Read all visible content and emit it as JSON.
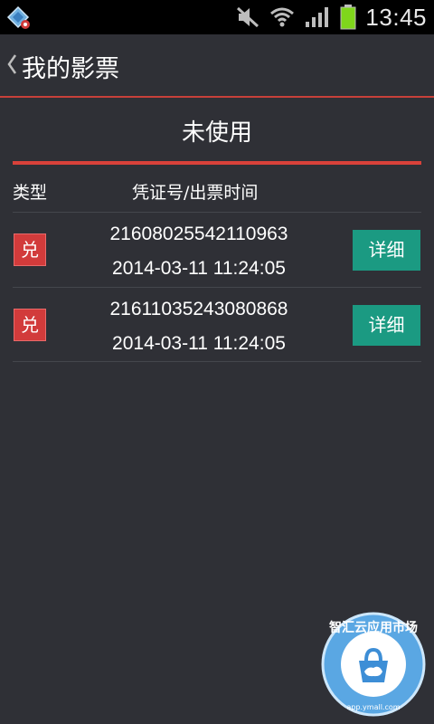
{
  "status_bar": {
    "time": "13:45",
    "icons": [
      "app-notification-icon",
      "mute-icon",
      "wifi-icon",
      "signal-icon",
      "battery-icon"
    ]
  },
  "header": {
    "back_icon": "chevron-left-icon",
    "title": "我的影票"
  },
  "tab": {
    "label": "未使用",
    "underline_color": "#d9413a"
  },
  "columns": {
    "type": "类型",
    "code_time": "凭证号/出票时间"
  },
  "tickets": [
    {
      "type": "兑",
      "code": "21608025542110963",
      "time": "2014-03-11 11:24:05",
      "action": "详细"
    },
    {
      "type": "兑",
      "code": "21611035243080868",
      "time": "2014-03-11 11:24:05",
      "action": "详细"
    }
  ],
  "watermark": {
    "text": "智汇云应用市场",
    "url": "app.ymall.com"
  },
  "colors": {
    "background": "#2f3036",
    "accent": "#c8403a",
    "badge": "#d23b3b",
    "button": "#1b9a82"
  }
}
